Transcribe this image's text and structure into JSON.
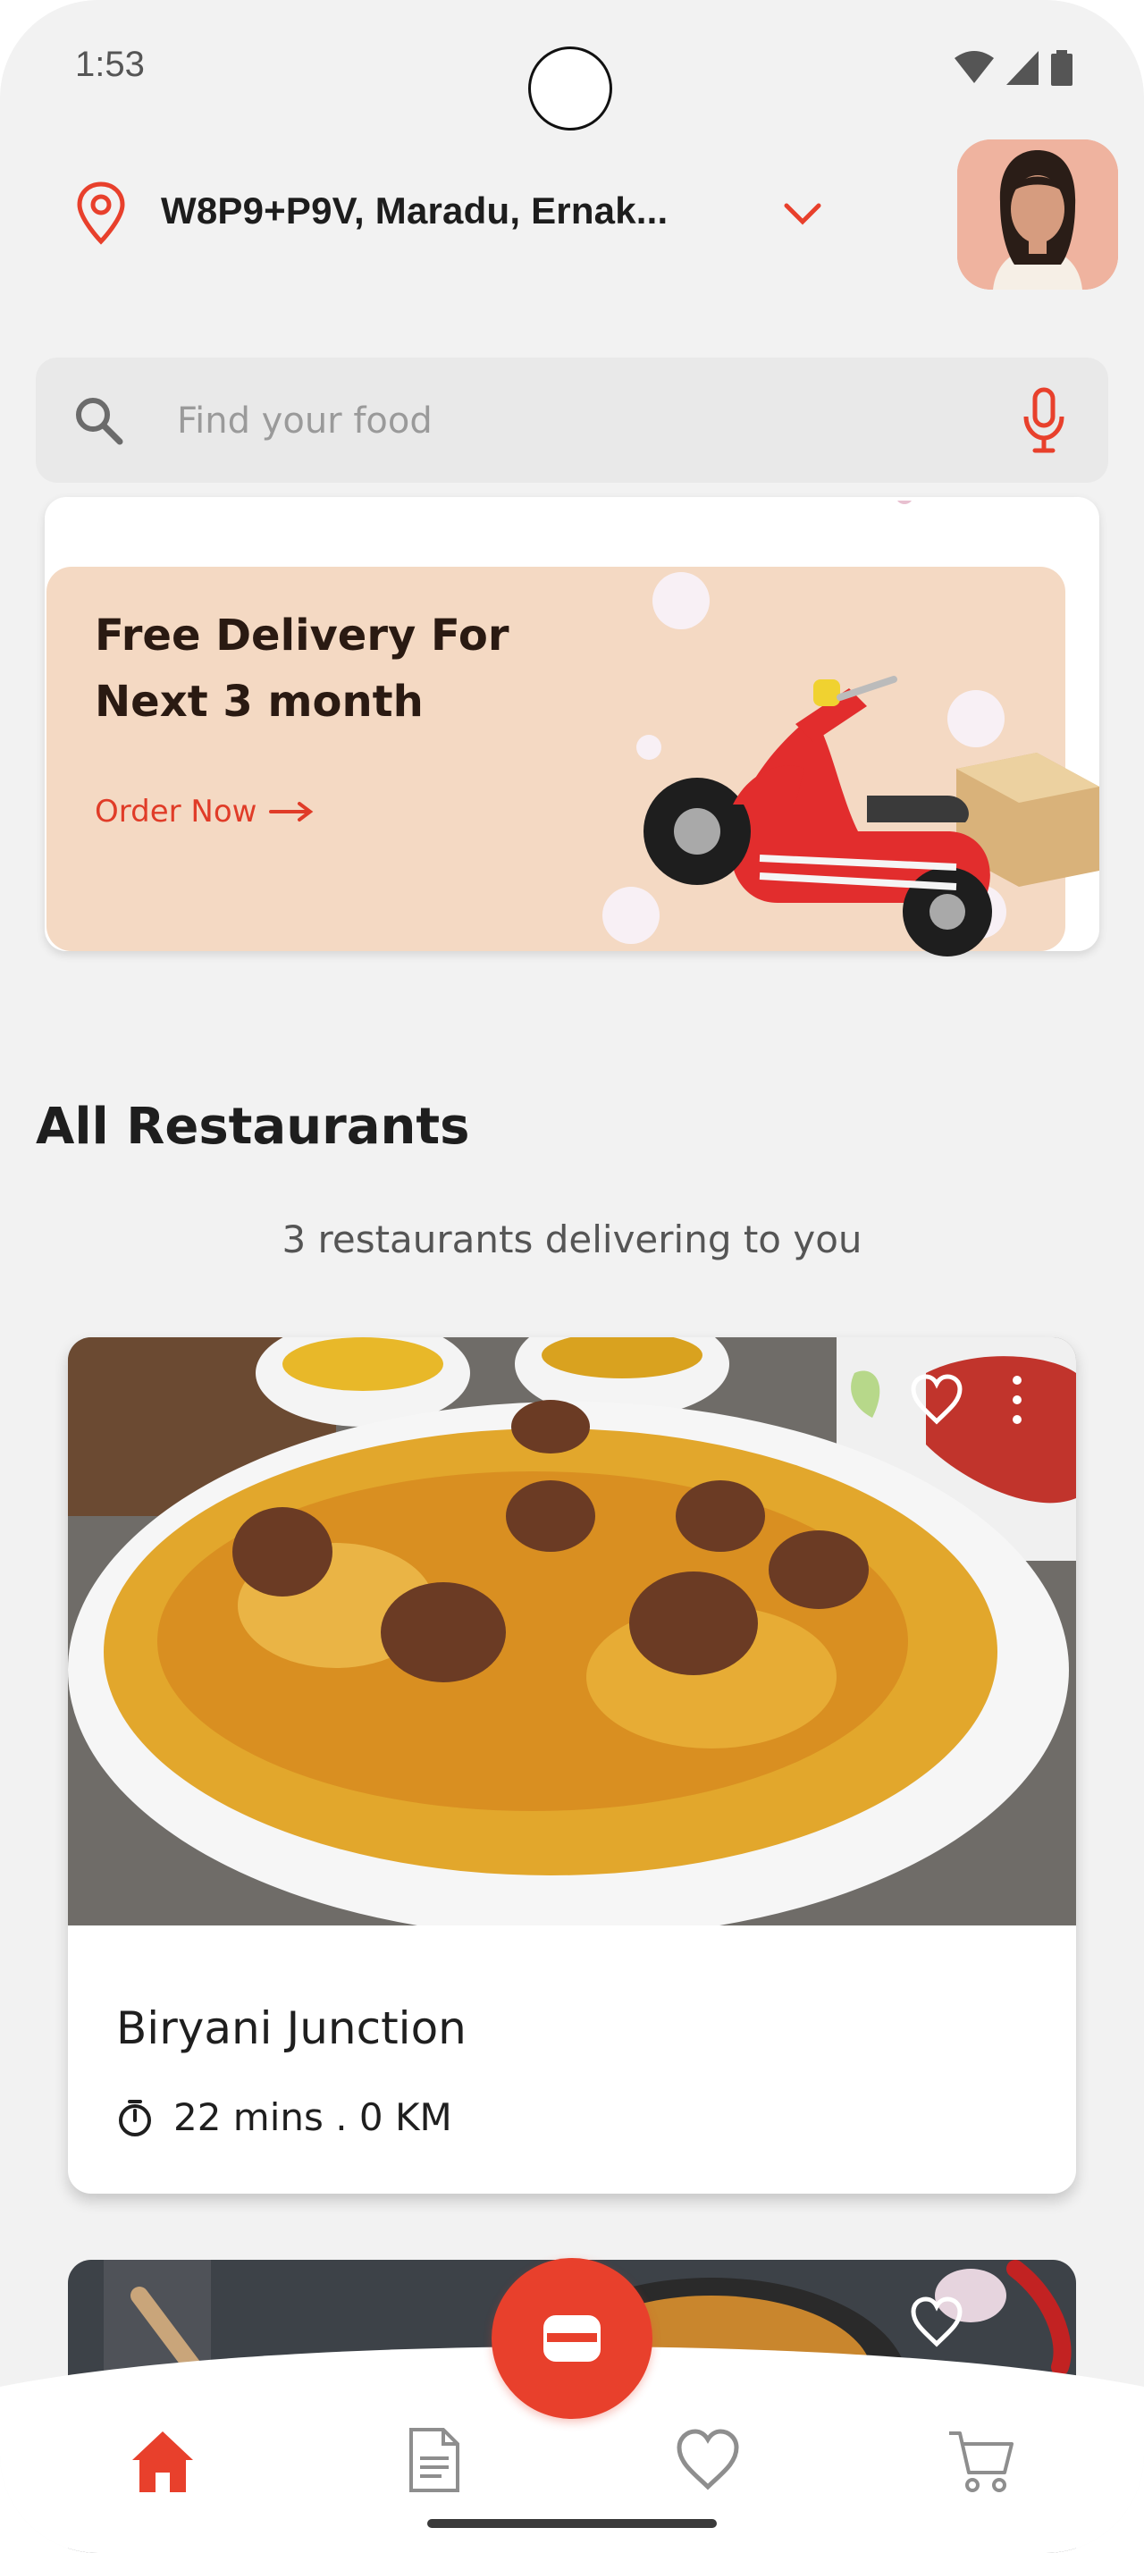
{
  "status_bar": {
    "time": "1:53"
  },
  "header": {
    "location": "W8P9+P9V, Maradu, Ernak...",
    "location_icon": "location-pin-icon",
    "dropdown_icon": "chevron-down-icon",
    "avatar_icon": "avatar"
  },
  "search": {
    "placeholder": "Find your food",
    "search_icon": "search-icon",
    "mic_icon": "microphone-icon"
  },
  "banner": {
    "title_line1": "Free Delivery For",
    "title_line2": "Next 3 month",
    "cta": "Order Now"
  },
  "restaurants": {
    "title": "All Restaurants",
    "subtitle": "3 restaurants delivering to you",
    "items": [
      {
        "name": "Biryani Junction",
        "meta": "22 mins . 0 KM"
      }
    ]
  },
  "nav": {
    "items": [
      "home-icon",
      "orders-icon",
      "favorites-icon",
      "cart-icon"
    ],
    "fab_icon": "wallet-icon"
  },
  "colors": {
    "accent": "#e8402c",
    "banner_bg": "#f4d9c3",
    "background": "#f2f2f2"
  }
}
